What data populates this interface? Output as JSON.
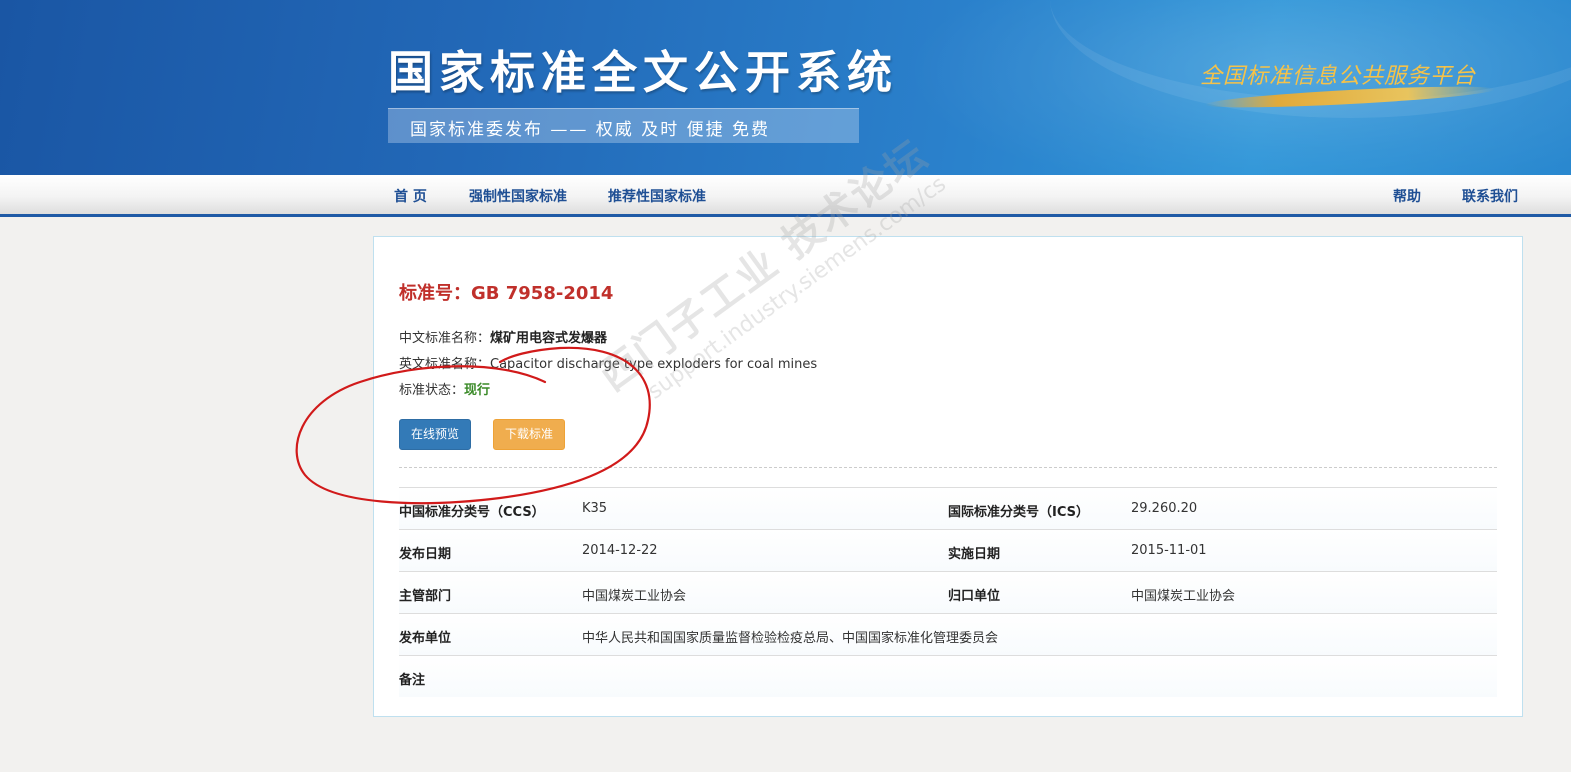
{
  "banner": {
    "title": "国家标准全文公开系统",
    "subtitle": "国家标准委发布 —— 权威 及时 便捷 免费",
    "slogan": "全国标准信息公共服务平台"
  },
  "nav": {
    "left": [
      "首 页",
      "强制性国家标准",
      "推荐性国家标准"
    ],
    "right": [
      "帮助",
      "联系我们"
    ]
  },
  "standard": {
    "number_label": "标准号：",
    "number": "GB 7958-2014",
    "cn_name_label": "中文标准名称：",
    "cn_name": "煤矿用电容式发爆器",
    "en_name_label": "英文标准名称：",
    "en_name": "Capacitor discharge type exploders for coal mines",
    "status_label": "标准状态：",
    "status": "现行"
  },
  "buttons": {
    "preview": "在线预览",
    "download": "下载标准"
  },
  "details": {
    "ccs_label": "中国标准分类号（CCS）",
    "ccs": "K35",
    "ics_label": "国际标准分类号（ICS）",
    "ics": "29.260.20",
    "publish_date_label": "发布日期",
    "publish_date": "2014-12-22",
    "implement_date_label": "实施日期",
    "implement_date": "2015-11-01",
    "authority_label": "主管部门",
    "authority": "中国煤炭工业协会",
    "centralized_label": "归口单位",
    "centralized": "中国煤炭工业协会",
    "publisher_label": "发布单位",
    "publisher": "中华人民共和国国家质量监督检验检疫总局、中国国家标准化管理委员会",
    "remark_label": "备注",
    "remark": ""
  },
  "watermark": {
    "line1": "西门子工业  技术论坛",
    "line2": "support.industry.siemens.com/cs"
  },
  "colors": {
    "brand_blue": "#1f5aa6",
    "std_red": "#c0302b",
    "status_green": "#3a8a28",
    "preview_btn": "#337ab7",
    "download_btn": "#f0ad4e",
    "annotation_red": "#d11a1a"
  }
}
